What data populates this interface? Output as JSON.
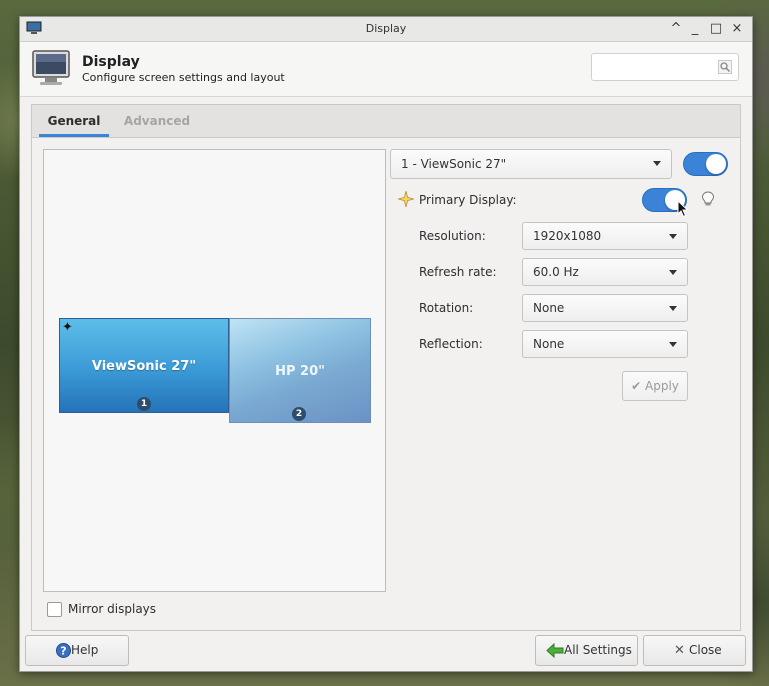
{
  "window": {
    "title": "Display",
    "controls": {
      "shade": "^",
      "minimize": "_",
      "maximize": "□",
      "close": "×"
    }
  },
  "header": {
    "title": "Display",
    "subtitle": "Configure screen settings and layout",
    "search_placeholder": ""
  },
  "tabs": [
    {
      "label": "General",
      "active": true
    },
    {
      "label": "Advanced",
      "active": false
    }
  ],
  "preview": {
    "monitors": [
      {
        "name": "ViewSonic 27\"",
        "number": "1",
        "primary": true
      },
      {
        "name": "HP 20\"",
        "number": "2",
        "primary": false
      }
    ]
  },
  "mirror": {
    "label": "Mirror displays",
    "checked": false
  },
  "settings": {
    "selected_display": "1 - ViewSonic 27\"",
    "display_enabled": true,
    "primary_label": "Primary Display:",
    "primary_on": true,
    "resolution_label": "Resolution:",
    "resolution_value": "1920x1080",
    "refresh_label": "Refresh rate:",
    "refresh_value": "60.0 Hz",
    "rotation_label": "Rotation:",
    "rotation_value": "None",
    "reflection_label": "Reflection:",
    "reflection_value": "None",
    "apply_label": "Apply"
  },
  "footer": {
    "help_label": "Help",
    "all_settings_label": "All Settings",
    "close_label": "Close"
  },
  "colors": {
    "accent": "#3a83d6",
    "tab_underline": "#3a86d4"
  }
}
